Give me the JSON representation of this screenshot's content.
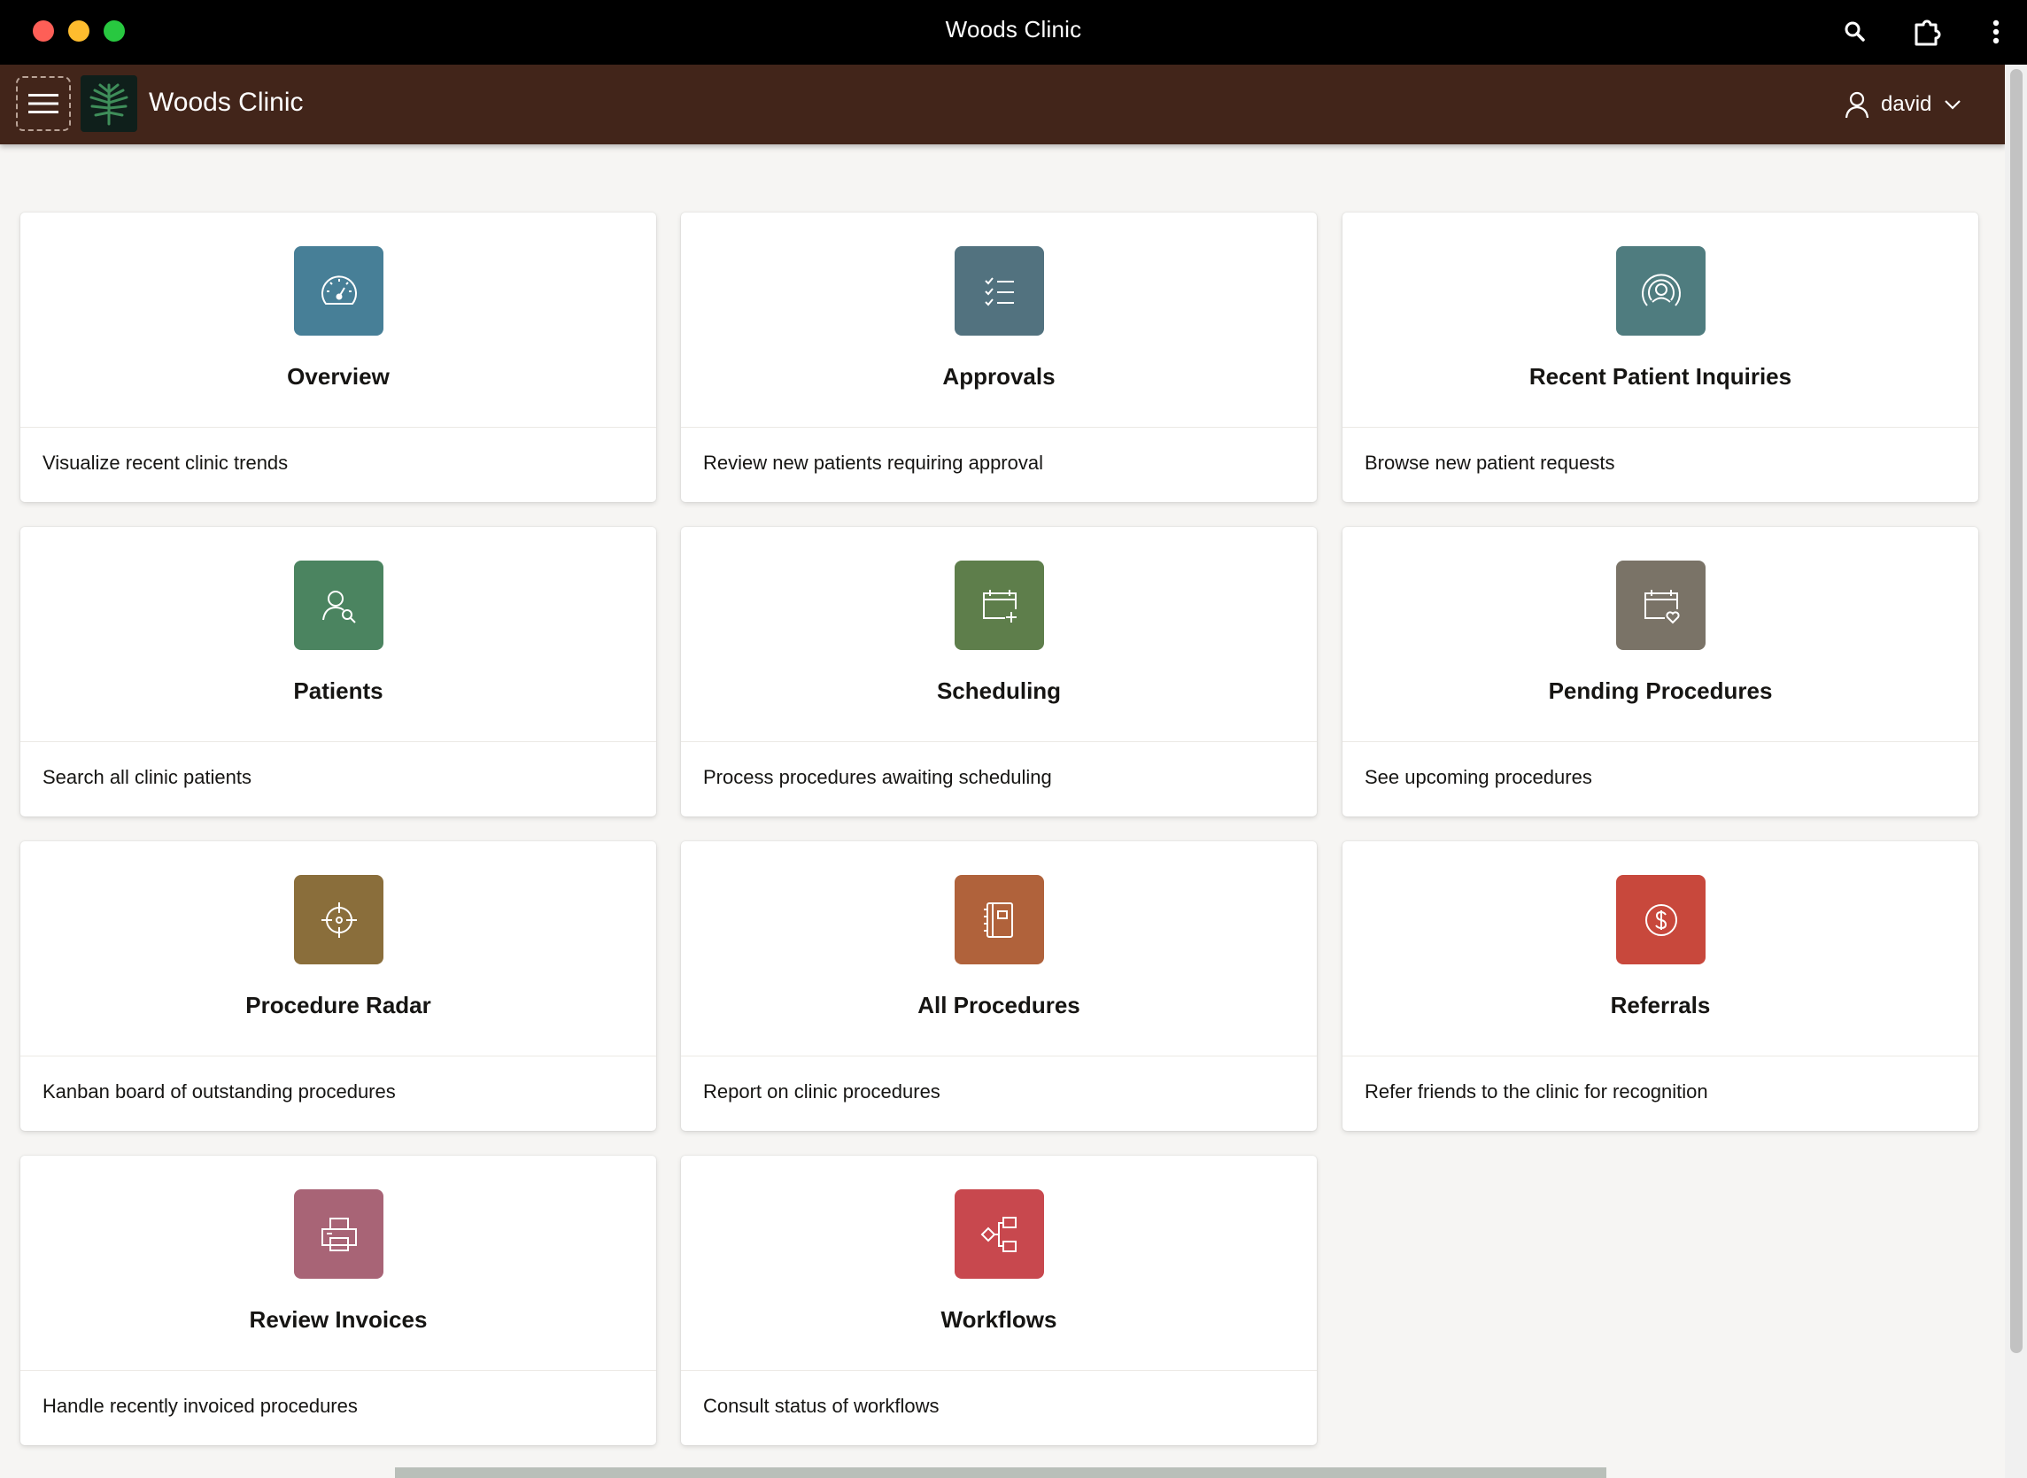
{
  "window": {
    "title": "Woods Clinic"
  },
  "header": {
    "app_title": "Woods Clinic",
    "user_name": "david"
  },
  "cards": [
    {
      "title": "Overview",
      "description": "Visualize recent clinic trends",
      "icon": "gauge-icon",
      "color": "#477f97"
    },
    {
      "title": "Approvals",
      "description": "Review new patients requiring approval",
      "icon": "checklist-icon",
      "color": "#52727f"
    },
    {
      "title": "Recent Patient Inquiries",
      "description": "Browse new patient requests",
      "icon": "broadcast-user-icon",
      "color": "#4f7c7f"
    },
    {
      "title": "Patients",
      "description": "Search all clinic patients",
      "icon": "user-search-icon",
      "color": "#4b8460"
    },
    {
      "title": "Scheduling",
      "description": "Process procedures awaiting scheduling",
      "icon": "calendar-add-icon",
      "color": "#5e7e4b"
    },
    {
      "title": "Pending Procedures",
      "description": "See upcoming procedures",
      "icon": "calendar-heart-icon",
      "color": "#7a7367"
    },
    {
      "title": "Procedure Radar",
      "description": "Kanban board of outstanding procedures",
      "icon": "crosshair-icon",
      "color": "#8a6e3b"
    },
    {
      "title": "All Procedures",
      "description": "Report on clinic procedures",
      "icon": "notebook-icon",
      "color": "#b0623b"
    },
    {
      "title": "Referrals",
      "description": "Refer friends to the clinic for recognition",
      "icon": "dollar-coin-icon",
      "color": "#c8483c"
    },
    {
      "title": "Review Invoices",
      "description": "Handle recently invoiced procedures",
      "icon": "printer-icon",
      "color": "#a86476"
    },
    {
      "title": "Workflows",
      "description": "Consult status of workflows",
      "icon": "workflow-icon",
      "color": "#c8484e"
    }
  ]
}
